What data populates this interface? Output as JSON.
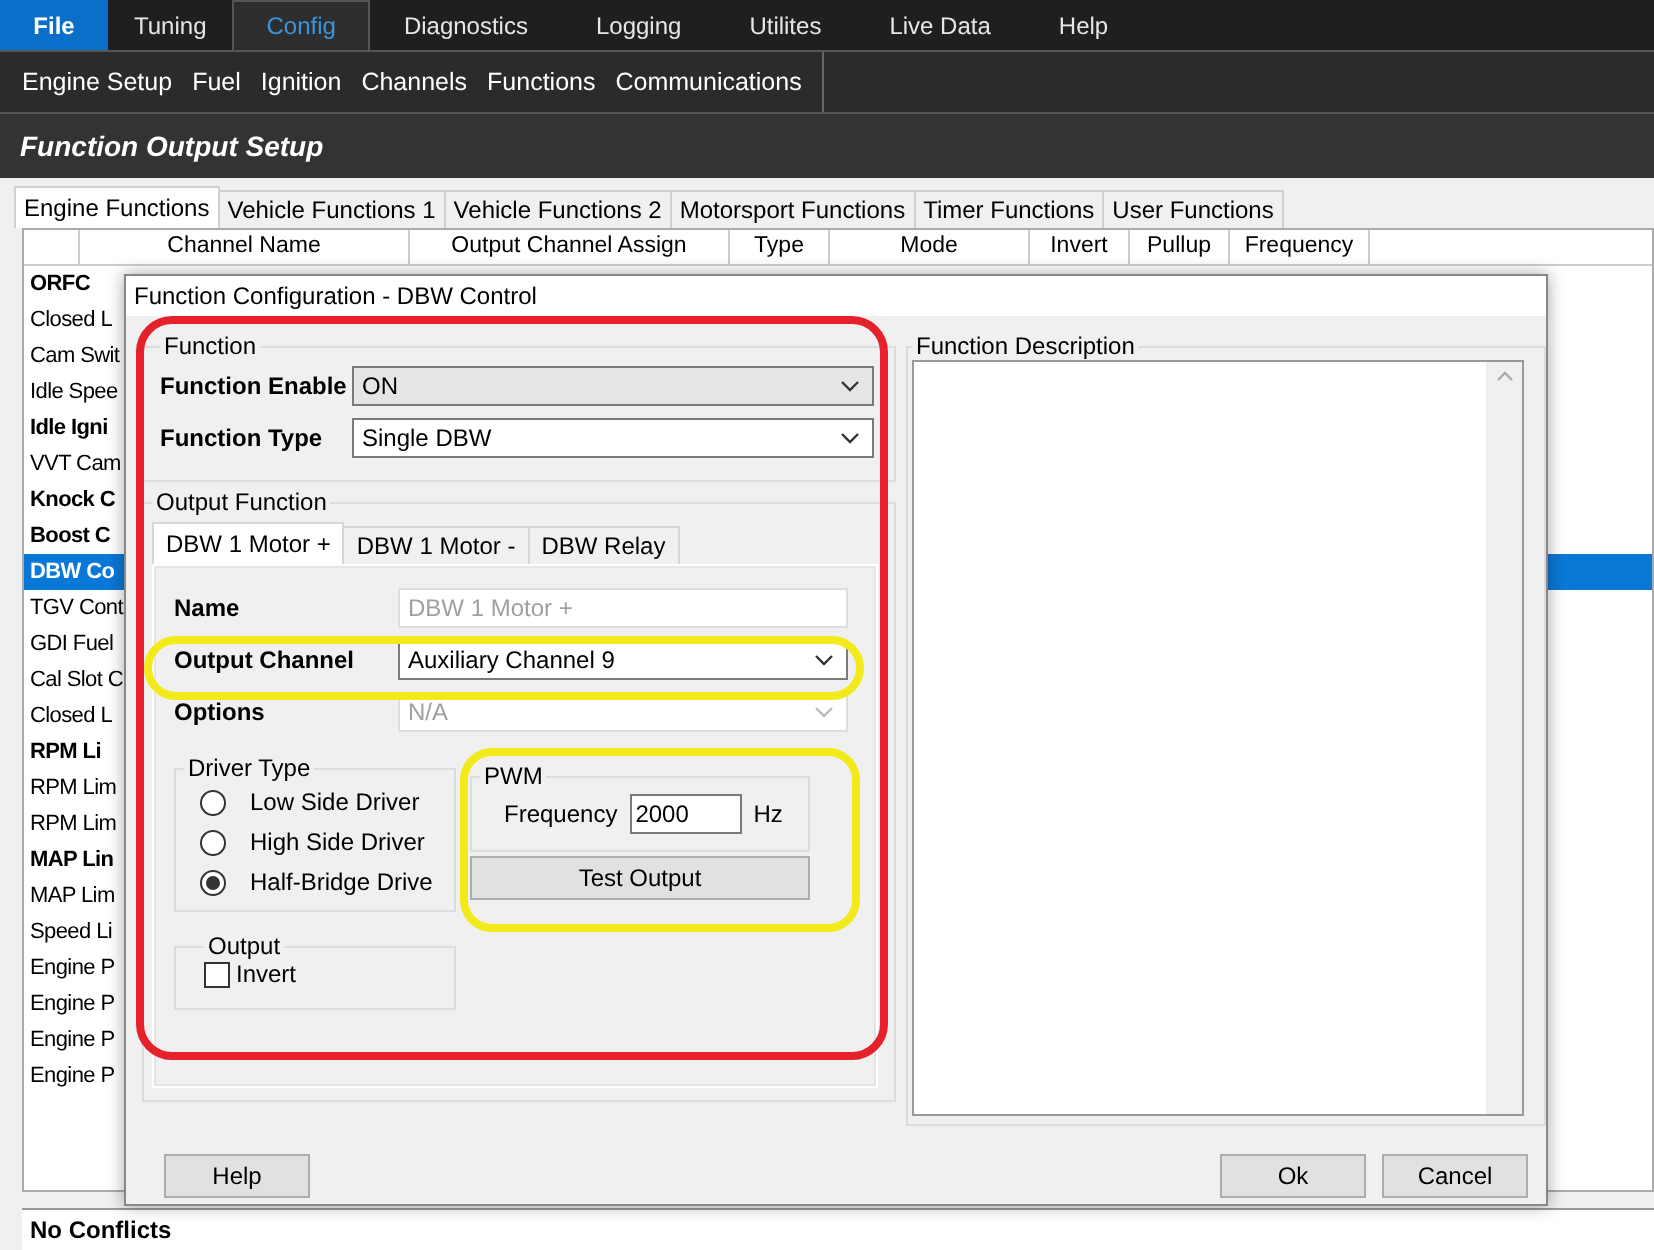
{
  "file_menu": {
    "label": "File"
  },
  "menu": [
    {
      "label": "Tuning",
      "selected": false
    },
    {
      "label": "Config",
      "selected": true
    },
    {
      "label": "Diagnostics",
      "selected": false
    },
    {
      "label": "Logging",
      "selected": false
    },
    {
      "label": "Utilites",
      "selected": false
    },
    {
      "label": "Live Data",
      "selected": false
    },
    {
      "label": "Help",
      "selected": false
    }
  ],
  "submenu": [
    "Engine Setup",
    "Fuel",
    "Ignition",
    "Channels",
    "Functions",
    "Communications"
  ],
  "page_title": "Function Output Setup",
  "tabs": [
    {
      "label": "Engine Functions",
      "selected": true
    },
    {
      "label": "Vehicle Functions 1",
      "selected": false
    },
    {
      "label": "Vehicle Functions 2",
      "selected": false
    },
    {
      "label": "Motorsport Functions",
      "selected": false
    },
    {
      "label": "Timer Functions",
      "selected": false
    },
    {
      "label": "User Functions",
      "selected": false
    }
  ],
  "table": {
    "columns": [
      "Channel Name",
      "Output Channel Assign",
      "Type",
      "Mode",
      "Invert",
      "Pullup",
      "Frequency"
    ],
    "rows": [
      {
        "name": "ORFC",
        "bold": true,
        "selected": false
      },
      {
        "name": "Closed L",
        "bold": false,
        "selected": false
      },
      {
        "name": "Cam Swit",
        "bold": false,
        "selected": false
      },
      {
        "name": "Idle Spee",
        "bold": false,
        "selected": false
      },
      {
        "name": "Idle Igni",
        "bold": true,
        "selected": false
      },
      {
        "name": "VVT Cam",
        "bold": false,
        "selected": false
      },
      {
        "name": "Knock C",
        "bold": true,
        "selected": false
      },
      {
        "name": "Boost C",
        "bold": true,
        "selected": false
      },
      {
        "name": "DBW Co",
        "bold": true,
        "selected": true
      },
      {
        "name": "TGV Cont",
        "bold": false,
        "selected": false
      },
      {
        "name": "GDI Fuel",
        "bold": false,
        "selected": false
      },
      {
        "name": "Cal Slot C",
        "bold": false,
        "selected": false
      },
      {
        "name": "Closed L",
        "bold": false,
        "selected": false
      },
      {
        "name": "RPM Li",
        "bold": true,
        "selected": false
      },
      {
        "name": "RPM Lim",
        "bold": false,
        "selected": false
      },
      {
        "name": "RPM Lim",
        "bold": false,
        "selected": false
      },
      {
        "name": "MAP Lin",
        "bold": true,
        "selected": false
      },
      {
        "name": "MAP Lim",
        "bold": false,
        "selected": false
      },
      {
        "name": "Speed Li",
        "bold": false,
        "selected": false
      },
      {
        "name": "Engine P",
        "bold": false,
        "selected": false
      },
      {
        "name": "Engine P",
        "bold": false,
        "selected": false
      },
      {
        "name": "Engine P",
        "bold": false,
        "selected": false
      },
      {
        "name": "Engine P",
        "bold": false,
        "selected": false
      }
    ]
  },
  "status_bar": "No Conflicts",
  "dialog": {
    "title": "Function Configuration - DBW Control",
    "function_group": {
      "title": "Function",
      "fields": [
        {
          "label": "Function Enable",
          "value": "ON",
          "readonly": true
        },
        {
          "label": "Function Type",
          "value": "Single DBW",
          "readonly": false
        }
      ]
    },
    "output_group": {
      "title": "Output Function",
      "tabs": [
        {
          "label": "DBW 1 Motor +",
          "selected": true
        },
        {
          "label": "DBW 1 Motor -",
          "selected": false
        },
        {
          "label": "DBW Relay",
          "selected": false
        }
      ],
      "fields": [
        {
          "label": "Name",
          "value": "DBW 1 Motor +",
          "kind": "text",
          "disabled": true
        },
        {
          "label": "Output Channel",
          "value": "Auxiliary Channel  9",
          "kind": "dropdown",
          "disabled": false
        },
        {
          "label": "Options",
          "value": "N/A",
          "kind": "dropdown",
          "disabled": true
        }
      ],
      "driver_type": {
        "title": "Driver Type",
        "options": [
          {
            "label": "Low Side Driver",
            "selected": false
          },
          {
            "label": "High Side Driver",
            "selected": false
          },
          {
            "label": "Half-Bridge Drive",
            "selected": true
          }
        ]
      },
      "pwm": {
        "title": "PWM",
        "label": "Frequency",
        "value": "2000",
        "unit": "Hz"
      },
      "test_button": "Test Output",
      "output": {
        "title": "Output",
        "invert": {
          "label": "Invert",
          "checked": false
        }
      }
    },
    "description": {
      "title": "Function Description"
    },
    "buttons": {
      "help": "Help",
      "ok": "Ok",
      "cancel": "Cancel"
    }
  },
  "annotations": [
    {
      "kind": "rounded-rect",
      "color": "#e5222b"
    },
    {
      "kind": "ellipse",
      "color": "#f2ea1a"
    },
    {
      "kind": "ellipse",
      "color": "#f2ea1a"
    }
  ]
}
